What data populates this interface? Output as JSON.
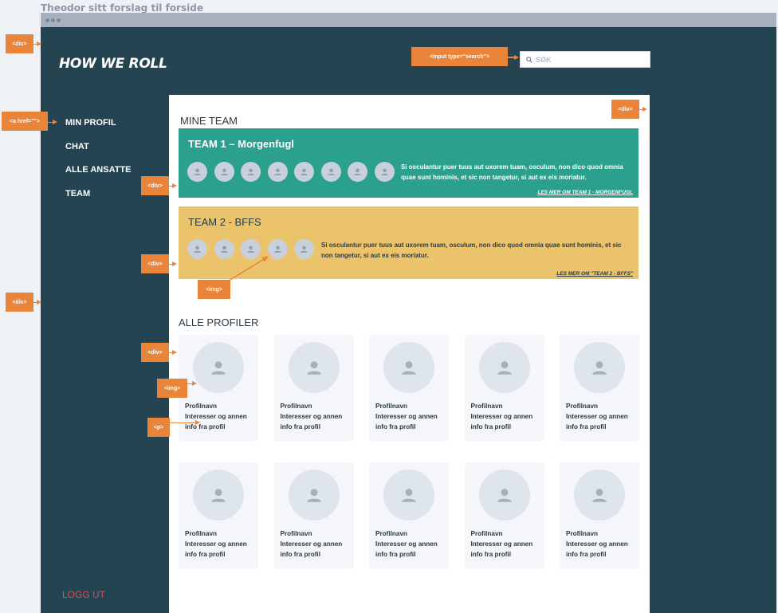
{
  "page_title": "Theodor sitt forslag til forside",
  "app": {
    "logo": "HOW WE ROLL",
    "search": {
      "placeholder": "SØK",
      "value": ""
    },
    "nav": [
      {
        "label": "MIN PROFIL"
      },
      {
        "label": "CHAT"
      },
      {
        "label": "ALLE ANSATTE"
      },
      {
        "label": "TEAM"
      }
    ],
    "logout": "LOGG UT"
  },
  "my_teams": {
    "title": "MINE TEAM",
    "teams": [
      {
        "name": "TEAM 1 – Morgenfugl",
        "member_count": 8,
        "description": "Si osculantur puer tuus aut uxorem tuam, osculum, non dico quod omnia quae sunt hominis, et sic non tangetur, si aut ex eis moriatur.",
        "more_link": "LES MER OM TEAM 1 - MORGENFUGL",
        "color": "#2ba08d"
      },
      {
        "name": "TEAM 2 - BFFS",
        "member_count": 5,
        "description": "Si osculantur puer tuus aut uxorem tuam, osculum, non dico quod omnia quae sunt hominis, et sic non tangetur, si aut ex eis moriatur.",
        "more_link": "LES MER OM \"TEAM 2 - BFFS\"",
        "color": "#eac36a"
      }
    ]
  },
  "all_profiles": {
    "title": "ALLE PROFILER",
    "profiles": [
      {
        "name": "Profilnavn",
        "info": "Interesser og annen info fra profil"
      },
      {
        "name": "Profilnavn",
        "info": "Interesser og annen info fra profil"
      },
      {
        "name": "Profilnavn",
        "info": "Interesser og annen info fra profil"
      },
      {
        "name": "Profilnavn",
        "info": "Interesser og annen info fra profil"
      },
      {
        "name": "Profilnavn",
        "info": "Interesser og annen info fra profil"
      },
      {
        "name": "Profilnavn",
        "info": "Interesser og annen info fra profil"
      },
      {
        "name": "Profilnavn",
        "info": "Interesser og annen info fra profil"
      },
      {
        "name": "Profilnavn",
        "info": "Interesser og annen info fra profil"
      },
      {
        "name": "Profilnavn",
        "info": "Interesser og annen info fra profil"
      },
      {
        "name": "Profilnavn",
        "info": "Interesser og annen info fra profil"
      }
    ]
  },
  "annotations": {
    "div": "<div>",
    "input": "<input type=\"search\">",
    "a": "<a href=\"\">",
    "img": "<img>",
    "p": "<p>"
  },
  "colors": {
    "app_bg": "#244451",
    "accent_annotation": "#e8853a",
    "logout": "#e04a58"
  }
}
